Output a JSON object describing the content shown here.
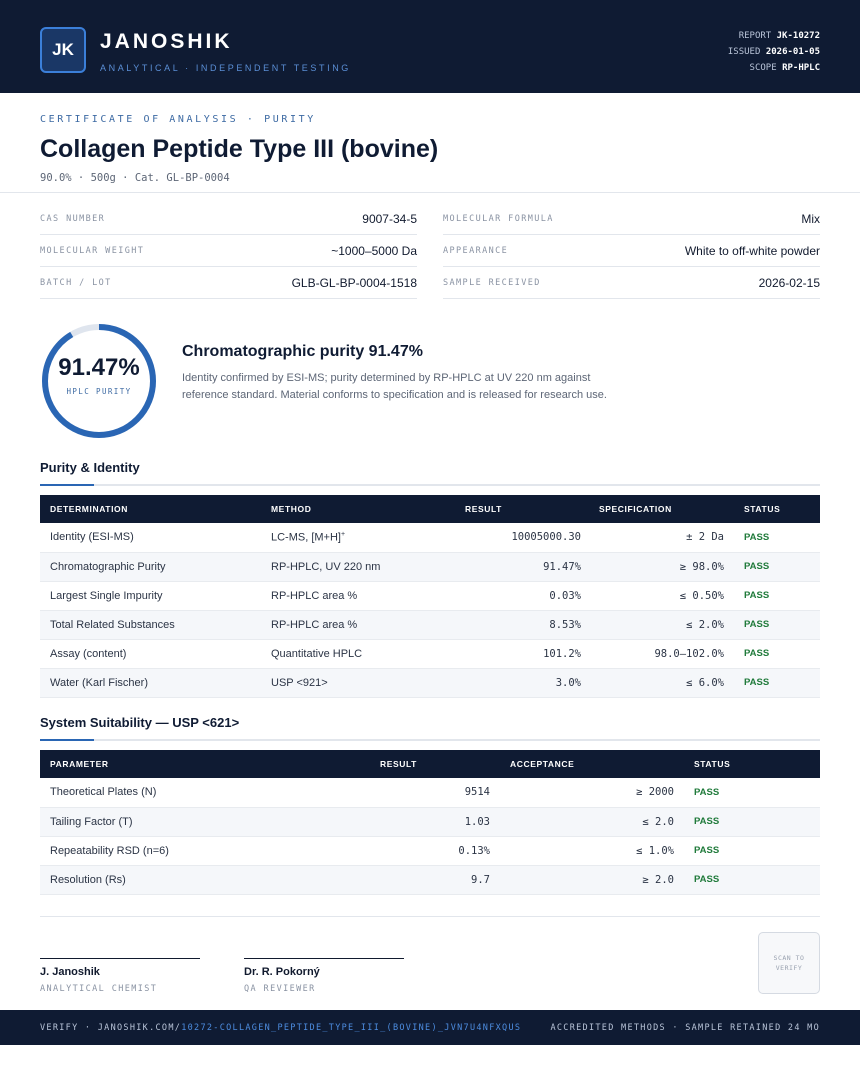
{
  "header": {
    "logo": "JK",
    "brand": "JANOSHIK",
    "tagline": "ANALYTICAL · INDEPENDENT TESTING",
    "report_label": "REPORT",
    "report_value": "JK-10272",
    "issued_label": "ISSUED",
    "issued_value": "2026-01-05",
    "scope_label": "SCOPE",
    "scope_value": "RP-HPLC"
  },
  "title_block": {
    "eyebrow": "CERTIFICATE OF ANALYSIS · PURITY",
    "title": "Collagen Peptide Type III (bovine)",
    "subline": "90.0% · 500g  ·  Cat. GL-BP-0004"
  },
  "info": [
    {
      "label": "CAS NUMBER",
      "value": "9007-34-5"
    },
    {
      "label": "MOLECULAR FORMULA",
      "value": "Mix"
    },
    {
      "label": "MOLECULAR WEIGHT",
      "value": "~1000–5000 Da"
    },
    {
      "label": "APPEARANCE",
      "value": "White to off-white powder"
    },
    {
      "label": "BATCH / LOT",
      "value": "GLB-GL-BP-0004-1518"
    },
    {
      "label": "SAMPLE RECEIVED",
      "value": "2026-02-15"
    }
  ],
  "purity": {
    "value": "91.47%",
    "fraction": 0.9147,
    "label": "HPLC PURITY",
    "summary_title": "Chromatographic purity 91.47%",
    "summary_text": "Identity confirmed by ESI-MS; purity determined by RP-HPLC at UV 220 nm against reference standard. Material conforms to specification and is released for research use."
  },
  "colors": {
    "accent": "#2a66b4",
    "navy": "#0f1b33",
    "pass": "#1f7a3a"
  },
  "purity_table": {
    "section_title": "Purity & Identity",
    "headers": [
      "DETERMINATION",
      "METHOD",
      "RESULT",
      "SPECIFICATION",
      "STATUS"
    ],
    "rows": [
      {
        "determination": "Identity (ESI-MS)",
        "method": "LC-MS, [M+H]",
        "method_sup": "+",
        "result": "10005000.30",
        "spec": "± 2 Da",
        "status": "PASS"
      },
      {
        "determination": "Chromatographic Purity",
        "method": "RP-HPLC, UV 220 nm",
        "method_sup": "",
        "result": "91.47%",
        "spec": "≥ 98.0%",
        "status": "PASS"
      },
      {
        "determination": "Largest Single Impurity",
        "method": "RP-HPLC area %",
        "method_sup": "",
        "result": "0.03%",
        "spec": "≤ 0.50%",
        "status": "PASS"
      },
      {
        "determination": "Total Related Substances",
        "method": "RP-HPLC area %",
        "method_sup": "",
        "result": "8.53%",
        "spec": "≤ 2.0%",
        "status": "PASS"
      },
      {
        "determination": "Assay (content)",
        "method": "Quantitative HPLC",
        "method_sup": "",
        "result": "101.2%",
        "spec": "98.0–102.0%",
        "status": "PASS"
      },
      {
        "determination": "Water (Karl Fischer)",
        "method": "USP <921>",
        "method_sup": "",
        "result": "3.0%",
        "spec": "≤ 6.0%",
        "status": "PASS"
      }
    ]
  },
  "suitability_table": {
    "section_title": "System Suitability — USP <621>",
    "headers": [
      "PARAMETER",
      "RESULT",
      "ACCEPTANCE",
      "STATUS"
    ],
    "rows": [
      {
        "parameter": "Theoretical Plates (N)",
        "result": "9514",
        "acceptance": "≥ 2000",
        "status": "PASS"
      },
      {
        "parameter": "Tailing Factor (T)",
        "result": "1.03",
        "acceptance": "≤ 2.0",
        "status": "PASS"
      },
      {
        "parameter": "Repeatability RSD (n=6)",
        "result": "0.13%",
        "acceptance": "≤ 1.0%",
        "status": "PASS"
      },
      {
        "parameter": "Resolution (Rs)",
        "result": "9.7",
        "acceptance": "≥ 2.0",
        "status": "PASS"
      }
    ]
  },
  "signatures": [
    {
      "name": "J. Janoshik",
      "role": "ANALYTICAL CHEMIST"
    },
    {
      "name": "Dr. R. Pokorný",
      "role": "QA REVIEWER"
    }
  ],
  "qr_text": "SCAN TO VERIFY",
  "footer": {
    "verify_prefix": "VERIFY · JANOSHIK.COM/",
    "verify_link": "10272-COLLAGEN_PEPTIDE_TYPE_III_(BOVINE)_JVN7U4NFXQUS",
    "right": "ACCREDITED METHODS · SAMPLE RETAINED 24 MO"
  }
}
